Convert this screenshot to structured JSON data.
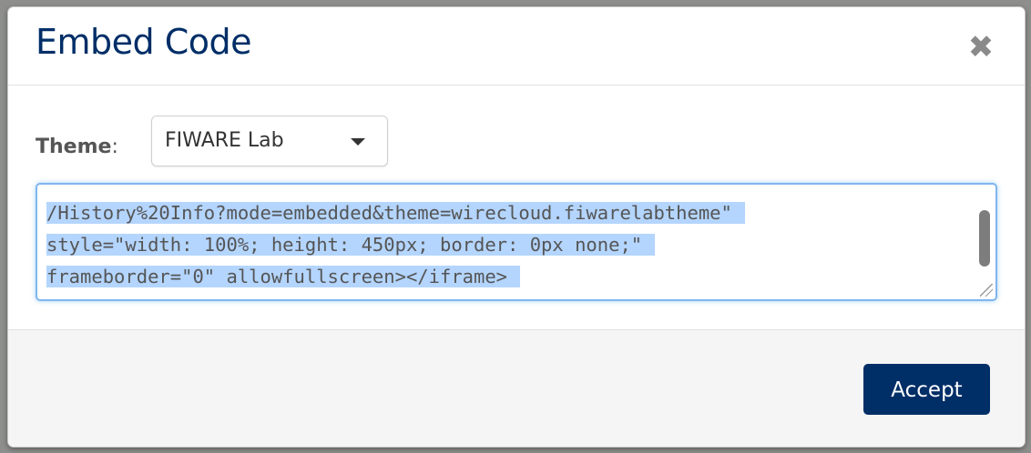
{
  "dialog": {
    "title": "Embed Code",
    "close_icon": "close-icon",
    "close_glyph": "✖"
  },
  "theme": {
    "label": "Theme",
    "separator": ":",
    "selected": "FIWARE Lab",
    "dropdown_icon": "chevron-down-icon"
  },
  "code": {
    "lines": [
      "/History%20Info?mode=embedded&theme=wirecloud.fiwarelabtheme\"",
      "style=\"width: 100%; height: 450px; border: 0px none;\"",
      "frameborder=\"0\" allowfullscreen></iframe>"
    ]
  },
  "footer": {
    "accept_label": "Accept"
  },
  "colors": {
    "brand": "#002e67",
    "selection": "#b4d5fe",
    "focus_border": "#7fb6ee"
  }
}
